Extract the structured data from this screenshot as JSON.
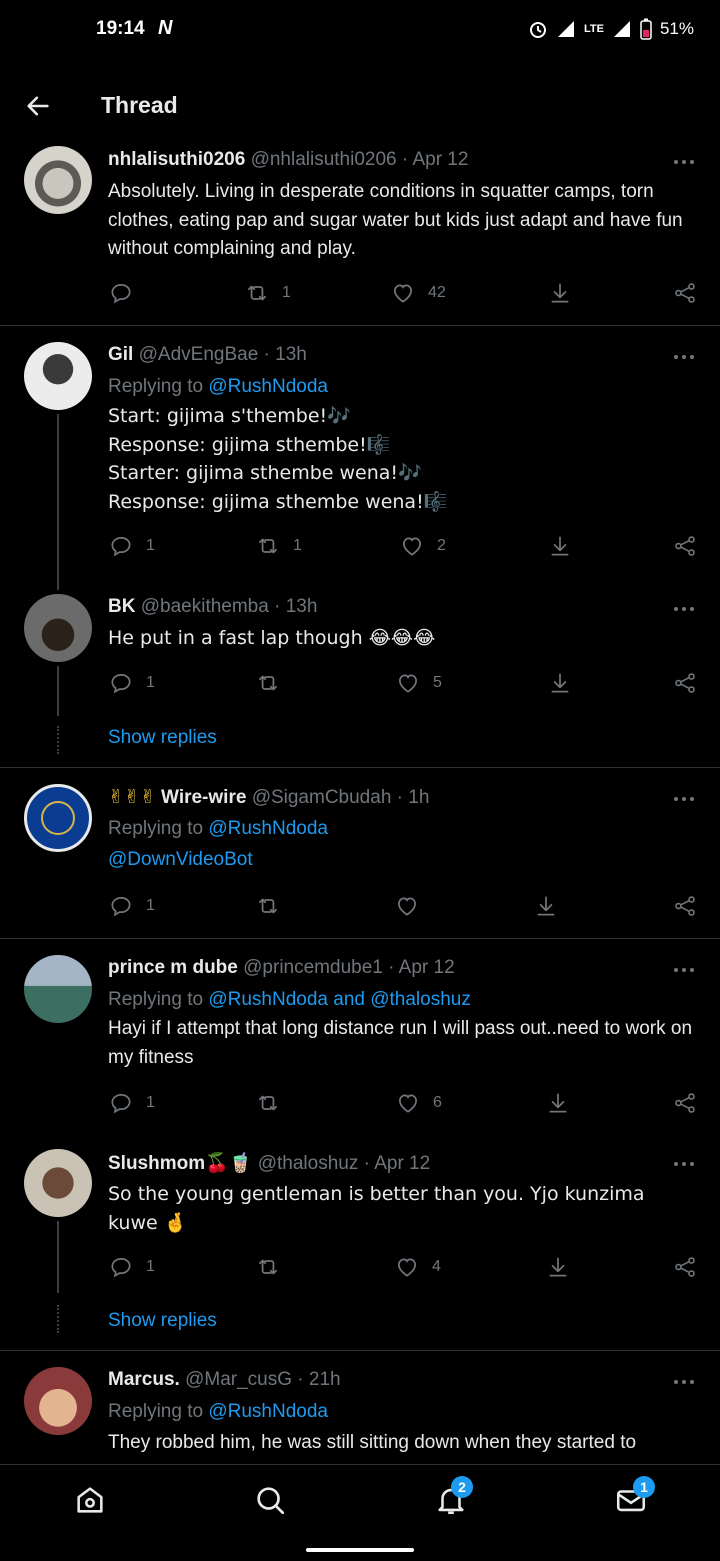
{
  "status": {
    "time": "19:14",
    "carrier_icon": "N",
    "network": "LTE",
    "battery": "51%"
  },
  "header": {
    "title": "Thread"
  },
  "tweets": [
    {
      "name": "nhlalisuthi0206",
      "handle": "@nhlalisuthi0206",
      "time": "· Apr 12",
      "body": "Absolutely. Living in desperate conditions in squatter camps, torn clothes, eating pap and sugar water but kids just adapt and have fun without complaining and play.",
      "retweets": "1",
      "likes": "42",
      "replies": ""
    },
    {
      "name": "Gil",
      "handle": "@AdvEngBae",
      "time": "· 13h",
      "replying_prefix": "Replying to",
      "replying_to": "@RushNdoda",
      "lines": [
        "Start: gijima s'thembe!🎶",
        "Response: gijima sthembe!🎼",
        "Starter: gijima sthembe wena!🎶",
        "Response: gijima sthembe wena!🎼"
      ],
      "replies": "1",
      "retweets": "1",
      "likes": "2"
    },
    {
      "name": "BK",
      "handle": "@baekithemba",
      "time": "· 13h",
      "body": "He put in a fast lap though 😂😂😂",
      "replies": "1",
      "retweets": "",
      "likes": "5",
      "show_replies": "Show replies"
    },
    {
      "name_prefix": "✌✌✌",
      "name": "Wire-wire",
      "handle": "@SigamCbudah",
      "time": "· 1h",
      "replying_prefix": "Replying to",
      "replying_to": "@RushNdoda",
      "body_link": "@DownVideoBot",
      "replies": "1",
      "retweets": "",
      "likes": ""
    },
    {
      "name": "prince m dube",
      "handle": "@princemdube1",
      "time": "· Apr 12",
      "replying_prefix": "Replying to",
      "replying_to": "@RushNdoda and @thaloshuz",
      "body": "Hayi if I attempt that long distance run I will pass out..need to work on my fitness",
      "replies": "1",
      "retweets": "",
      "likes": "6"
    },
    {
      "name": "Slushmom",
      "name_suffix": "🍒🧋",
      "handle": "@thaloshuz",
      "time": "· Apr 12",
      "body": "So the young gentleman is better than you. Yjo kunzima kuwe 🤞",
      "replies": "1",
      "retweets": "",
      "likes": "4",
      "show_replies": "Show replies"
    },
    {
      "name": "Marcus.",
      "handle": "@Mar_cusG",
      "time": "· 21h",
      "replying_prefix": "Replying to",
      "replying_to": "@RushNdoda",
      "body": "They robbed him, he was still sitting down when they started to"
    }
  ],
  "nav": {
    "notifications_badge": "2",
    "messages_badge": "1"
  },
  "colors": {
    "accent": "#1d9bf0",
    "muted": "#71767b",
    "divider": "#2f3336",
    "background": "#000000"
  },
  "icons": [
    "back-arrow-icon",
    "more-icon",
    "reply-icon",
    "retweet-icon",
    "like-icon",
    "download-icon",
    "share-icon",
    "home-icon",
    "search-icon",
    "bell-icon",
    "mail-icon"
  ]
}
